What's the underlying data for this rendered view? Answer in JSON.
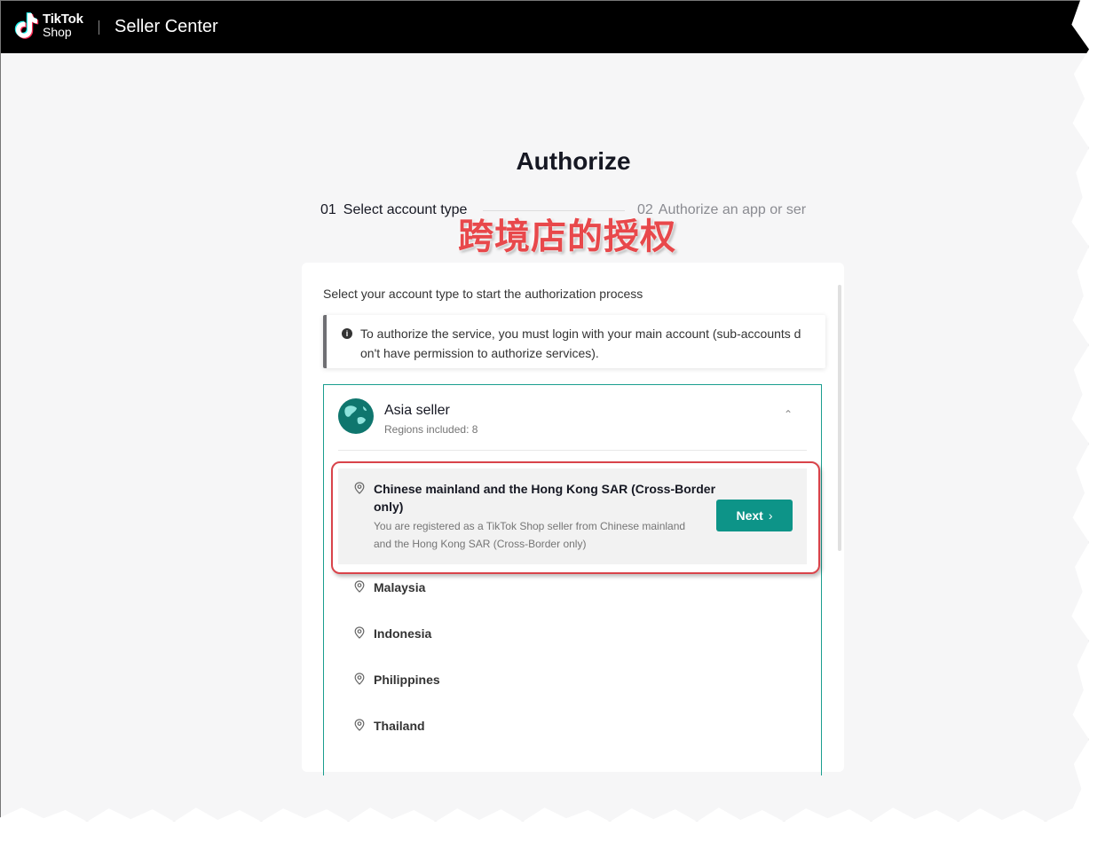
{
  "topbar": {
    "logo_line1": "TikTok",
    "logo_line2": "Shop",
    "app_title": "Seller Center"
  },
  "page": {
    "title": "Authorize",
    "steps": [
      {
        "number": "01",
        "label": "Select account type"
      },
      {
        "number": "02",
        "label": "Authorize an app or ser"
      }
    ],
    "annotation": "跨境店的授权"
  },
  "card": {
    "heading": "Select your account type to start the authorization process",
    "notice": "To authorize the service, you must login with your main account (sub-accounts don't have permission to authorize services).",
    "group": {
      "title": "Asia seller",
      "subtitle": "Regions included: 8",
      "selected_region": {
        "title": "Chinese mainland and the Hong Kong SAR (Cross-Border only)",
        "description": "You are registered as a TikTok Shop seller from Chinese mainland and the Hong Kong SAR (Cross-Border only)",
        "button": "Next"
      },
      "regions": [
        "Malaysia",
        "Indonesia",
        "Philippines",
        "Thailand"
      ]
    }
  },
  "colors": {
    "accent": "#0d9488",
    "annotation": "#e8484b",
    "topbar": "#000000"
  }
}
